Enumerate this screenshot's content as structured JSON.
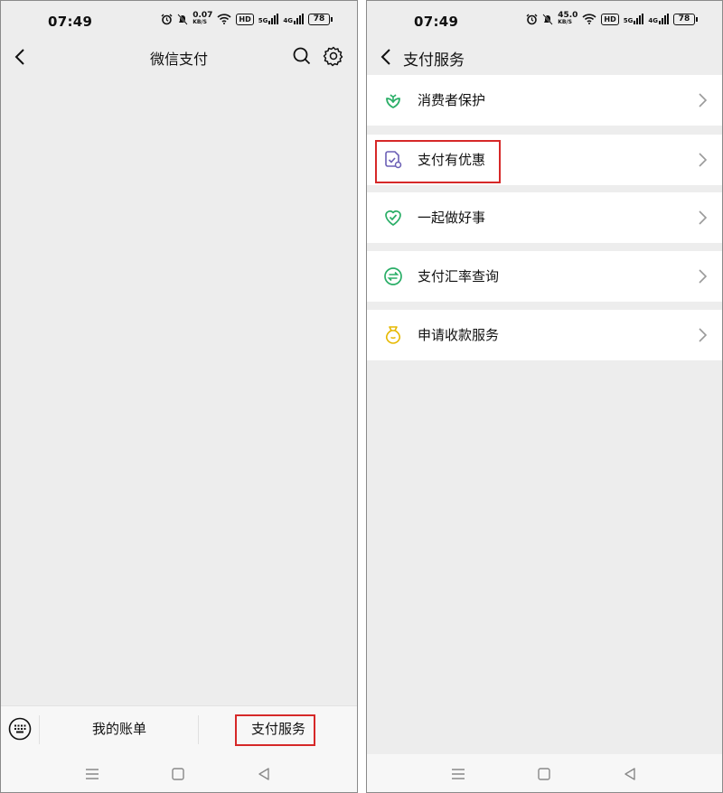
{
  "left": {
    "status": {
      "time": "07:49",
      "speed_value": "0.07",
      "speed_unit": "KB/S",
      "hd": "HD",
      "net1": "5G",
      "net2": "4G",
      "battery": "78"
    },
    "nav": {
      "title": "微信支付"
    },
    "tabbar": {
      "tab_bills": "我的账单",
      "tab_services": "支付服务"
    }
  },
  "right": {
    "status": {
      "time": "07:49",
      "speed_value": "45.0",
      "speed_unit": "KB/S",
      "hd": "HD",
      "net1": "5G",
      "net2": "4G",
      "battery": "78"
    },
    "nav": {
      "title": "支付服务"
    },
    "items": [
      {
        "label": "消费者保护",
        "icon": "shield-leaf-icon",
        "color": "#2aae67"
      },
      {
        "label": "支付有优惠",
        "icon": "coupon-check-icon",
        "color": "#6b5fb5"
      },
      {
        "label": "一起做好事",
        "icon": "heart-check-icon",
        "color": "#2aae67"
      },
      {
        "label": "支付汇率查询",
        "icon": "exchange-icon",
        "color": "#2aae67"
      },
      {
        "label": "申请收款服务",
        "icon": "money-bag-icon",
        "color": "#e6b800"
      }
    ]
  },
  "colors": {
    "highlight": "#d62828",
    "background": "#ededed"
  }
}
